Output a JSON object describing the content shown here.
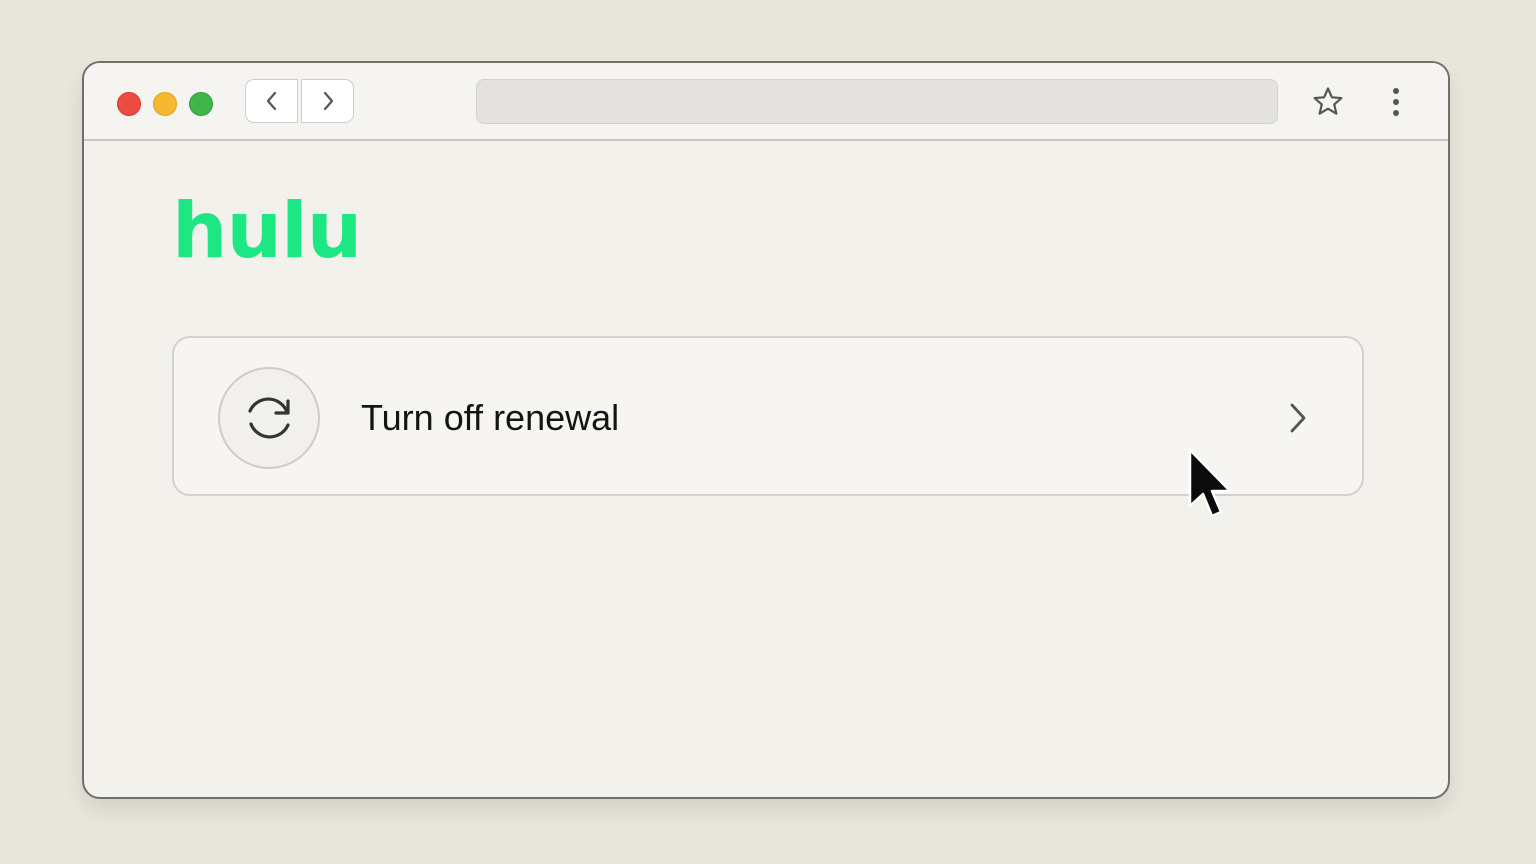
{
  "browser": {
    "address_url": "",
    "traffic_lights": {
      "close_color": "#ec4b42",
      "minimize_color": "#f5b82e",
      "maximize_color": "#3fb54a"
    },
    "icons": {
      "back": "chevron-left-icon",
      "forward": "chevron-right-icon",
      "bookmark": "star-icon",
      "menu": "more-vertical-icon"
    }
  },
  "page": {
    "logo_text": "hulu",
    "brand_color": "#1ce783",
    "action_item": {
      "label": "Turn off renewal",
      "icon": "refresh-icon",
      "trailing_icon": "chevron-right-icon"
    }
  },
  "pointer": {
    "icon": "mouse-pointer-icon"
  }
}
